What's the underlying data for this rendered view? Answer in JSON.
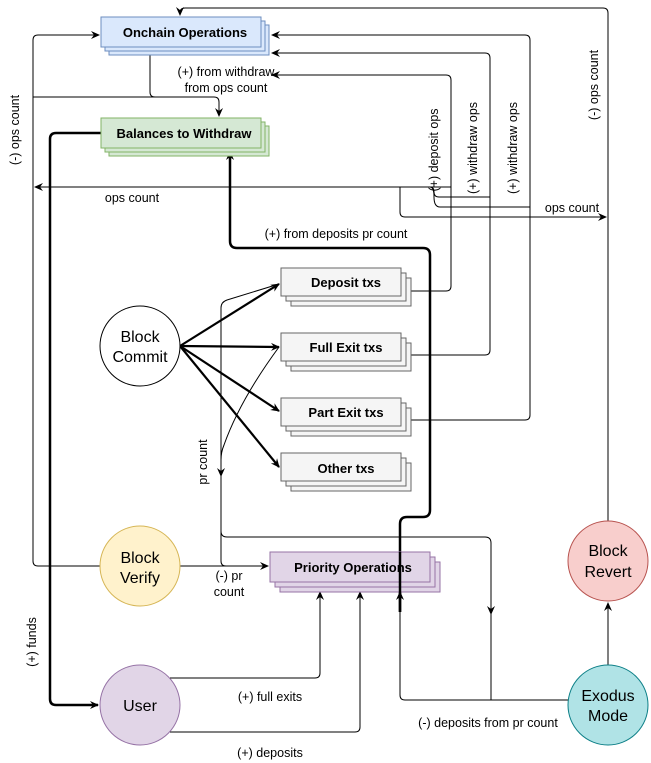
{
  "nodes": {
    "onchain_operations": "Onchain Operations",
    "balances_to_withdraw": "Balances to Withdraw",
    "deposit_txs": "Deposit txs",
    "full_exit_txs": "Full Exit txs",
    "part_exit_txs": "Part Exit txs",
    "other_txs": "Other txs",
    "priority_operations": "Priority Operations",
    "block_commit": [
      "Block",
      "Commit"
    ],
    "block_verify": [
      "Block",
      "Verify"
    ],
    "user": "User",
    "block_revert": [
      "Block",
      "Revert"
    ],
    "exodus_mode": [
      "Exodus",
      "Mode"
    ]
  },
  "edge_labels": {
    "from_withdraw": [
      "(+) from withdraw",
      "from ops count"
    ],
    "minus_ops_count_left": "(-) ops count",
    "minus_ops_count_right": "(-) ops count",
    "deposit_ops": "(+) deposit ops",
    "withdraw_ops_1": "(+) withdraw ops",
    "withdraw_ops_2": "(+) withdraw ops",
    "ops_count_left": "ops count",
    "ops_count_right": "ops count",
    "from_deposits_pr_count": "(+) from deposits pr count",
    "pr_count": "pr count",
    "minus_pr_count": [
      "(-) pr",
      "count"
    ],
    "funds": "(+) funds",
    "full_exits": "(+) full exits",
    "deposits": "(+) deposits",
    "minus_deposits_from_pr_count": "(-) deposits from pr count"
  },
  "colors": {
    "onchain": {
      "fill": "#dae8fc",
      "stroke": "#6c8ebf"
    },
    "balances": {
      "fill": "#d5e8d4",
      "stroke": "#82b366"
    },
    "txs": {
      "fill": "#f5f5f5",
      "stroke": "#666666"
    },
    "priority": {
      "fill": "#e1d5e7",
      "stroke": "#9673a6"
    },
    "verify": {
      "fill": "#fff2cc",
      "stroke": "#d6b656"
    },
    "user": {
      "fill": "#e1d5e7",
      "stroke": "#9673a6"
    },
    "revert": {
      "fill": "#f8cecc",
      "stroke": "#b85450"
    },
    "exodus": {
      "fill": "#b0e3e6",
      "stroke": "#0e8088"
    }
  }
}
